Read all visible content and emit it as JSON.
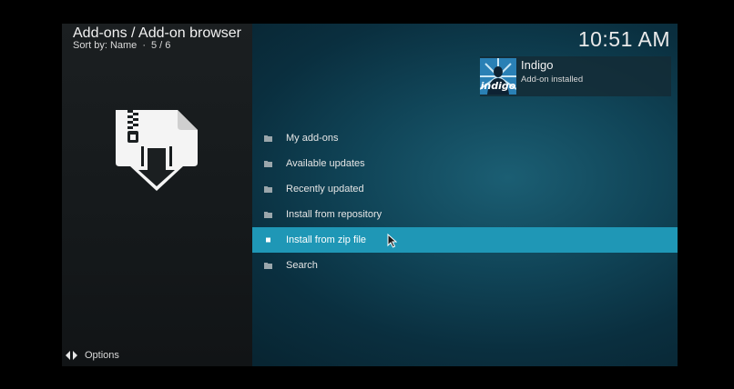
{
  "header": {
    "title": "Add-ons / Add-on browser",
    "sort_label": "Sort by: Name",
    "separator": "·",
    "position": "5 / 6",
    "clock": "10:51 AM"
  },
  "notification": {
    "title": "Indigo",
    "message": "Add-on installed",
    "thumb_text": "indigo",
    "thumb_icon": "indigo-addon-icon"
  },
  "graphic": {
    "icon": "zip-file-install-icon"
  },
  "menu": {
    "focused_index": 4,
    "items": [
      {
        "label": "My add-ons",
        "icon": "folder-icon"
      },
      {
        "label": "Available updates",
        "icon": "folder-icon"
      },
      {
        "label": "Recently updated",
        "icon": "folder-icon"
      },
      {
        "label": "Install from repository",
        "icon": "folder-icon"
      },
      {
        "label": "Install from zip file",
        "icon": "square-icon"
      },
      {
        "label": "Search",
        "icon": "folder-icon"
      }
    ]
  },
  "footer": {
    "options_label": "Options",
    "options_icon": "options-arrows-icon"
  },
  "colors": {
    "focus": "#1f97b6",
    "panel_dark": "#1b1f21",
    "background_teal": "#104457"
  }
}
